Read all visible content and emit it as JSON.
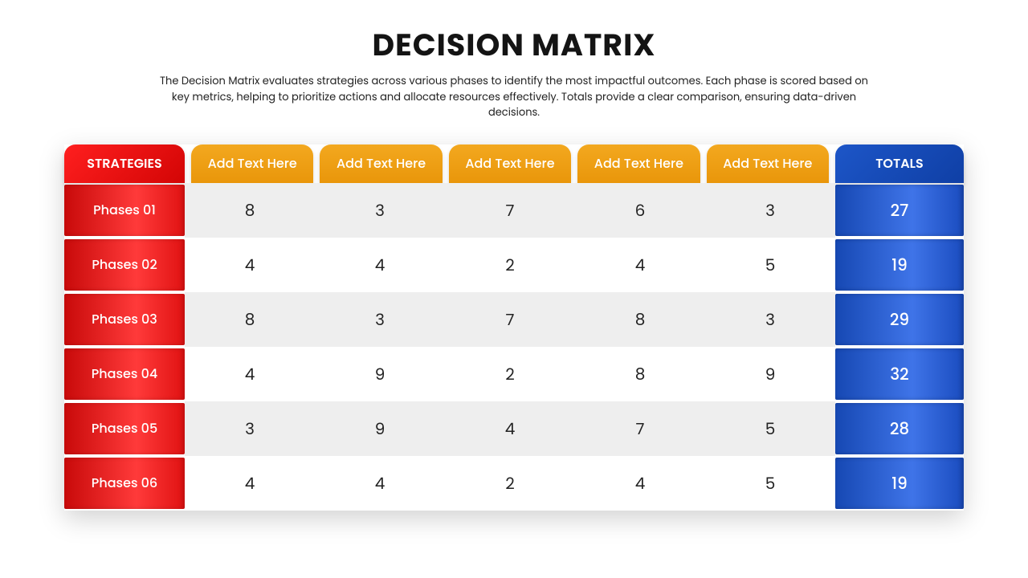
{
  "title": "DECISION MATRIX",
  "subtitle": "The Decision Matrix evaluates strategies across various phases to identify the most impactful outcomes. Each phase is scored based on key metrics, helping to prioritize actions and allocate resources effectively. Totals provide a clear comparison, ensuring data-driven decisions.",
  "headers": {
    "strategies": "STRATEGIES",
    "col1": "Add Text Here",
    "col2": "Add Text Here",
    "col3": "Add Text Here",
    "col4": "Add Text Here",
    "col5": "Add Text Here",
    "totals": "TOTALS"
  },
  "rows": [
    {
      "phase": "Phases 01",
      "c1": "8",
      "c2": "3",
      "c3": "7",
      "c4": "6",
      "c5": "3",
      "total": "27"
    },
    {
      "phase": "Phases 02",
      "c1": "4",
      "c2": "4",
      "c3": "2",
      "c4": "4",
      "c5": "5",
      "total": "19"
    },
    {
      "phase": "Phases 03",
      "c1": "8",
      "c2": "3",
      "c3": "7",
      "c4": "8",
      "c5": "3",
      "total": "29"
    },
    {
      "phase": "Phases 04",
      "c1": "4",
      "c2": "9",
      "c3": "2",
      "c4": "8",
      "c5": "9",
      "total": "32"
    },
    {
      "phase": "Phases 05",
      "c1": "3",
      "c2": "9",
      "c3": "4",
      "c4": "7",
      "c5": "5",
      "total": "28"
    },
    {
      "phase": "Phases 06",
      "c1": "4",
      "c2": "4",
      "c3": "2",
      "c4": "4",
      "c5": "5",
      "total": "19"
    }
  ],
  "chart_data": {
    "type": "table",
    "title": "DECISION MATRIX",
    "columns": [
      "STRATEGIES",
      "Add Text Here",
      "Add Text Here",
      "Add Text Here",
      "Add Text Here",
      "Add Text Here",
      "TOTALS"
    ],
    "rows": [
      [
        "Phases 01",
        8,
        3,
        7,
        6,
        3,
        27
      ],
      [
        "Phases 02",
        4,
        4,
        2,
        4,
        5,
        19
      ],
      [
        "Phases 03",
        8,
        3,
        7,
        8,
        3,
        29
      ],
      [
        "Phases 04",
        4,
        9,
        2,
        8,
        9,
        32
      ],
      [
        "Phases 05",
        3,
        9,
        4,
        7,
        5,
        28
      ],
      [
        "Phases 06",
        4,
        4,
        2,
        4,
        5,
        19
      ]
    ]
  }
}
